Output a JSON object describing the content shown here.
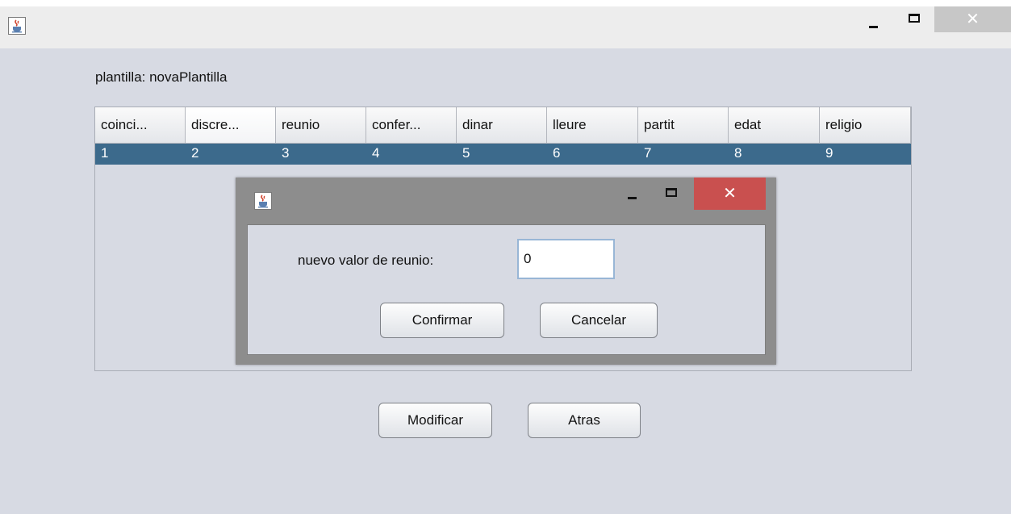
{
  "window": {
    "icon": "java-coffee-icon",
    "controls": {
      "minimize": "minimize-icon",
      "maximize": "maximize-icon",
      "close": "✕"
    }
  },
  "template_label": "plantilla: novaPlantilla",
  "table": {
    "columns": [
      "coinci...",
      "discre...",
      "reunio",
      "confer...",
      "dinar",
      "lleure",
      "partit",
      "edat",
      "religio"
    ],
    "rows": [
      [
        "1",
        "2",
        "3",
        "4",
        "5",
        "6",
        "7",
        "8",
        "9"
      ]
    ],
    "selected_row_color": "#3c6a8c"
  },
  "dialog": {
    "icon": "java-coffee-icon",
    "close": "✕",
    "close_color": "#c9504f",
    "field_label": "nuevo valor de reunio:",
    "field_value": "0",
    "confirm_label": "Confirmar",
    "cancel_label": "Cancelar"
  },
  "buttons": {
    "modify_label": "Modificar",
    "back_label": "Atras"
  }
}
